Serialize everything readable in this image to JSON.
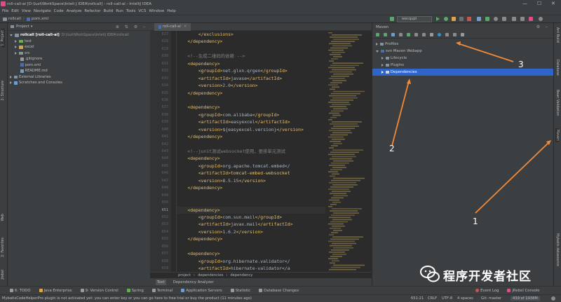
{
  "window": {
    "title": "roll-call-ai [D:\\luzi\\WorkSpace\\Inteli J IDEA\\rollcall] - roll-call-ai - IntelliJ IDEA",
    "controls": [
      "—",
      "☐",
      "✕"
    ]
  },
  "menu": [
    "File",
    "Edit",
    "View",
    "Navigate",
    "Code",
    "Analyze",
    "Refactor",
    "Build",
    "Run",
    "Tools",
    "VCS",
    "Window",
    "Help"
  ],
  "navbar": {
    "project": "rollcall",
    "file": "pom.xml",
    "run_config": "wecqupt"
  },
  "left_strip": [
    "1: Project",
    "2: Structure",
    "Web",
    "2: Favorites",
    "Jrebel"
  ],
  "right_strip": [
    "Ant Build",
    "Database",
    "Bean Validation",
    "Maven",
    "Mybatis datasource"
  ],
  "project_panel": {
    "header": "Project",
    "items": [
      {
        "label": "rollcall [roll-call-ai]",
        "path": "D:\\luzi\\WorkSpace\\InteliJ IDEA\\rollcall",
        "indent": 0,
        "kind": "module"
      },
      {
        "label": "test",
        "indent": 1,
        "kind": "folder-green"
      },
      {
        "label": "excel",
        "indent": 1,
        "kind": "folder-orange"
      },
      {
        "label": "src",
        "indent": 1,
        "kind": "folder"
      },
      {
        "label": ".gitignore",
        "indent": 1,
        "kind": "file"
      },
      {
        "label": "pom.xml",
        "indent": 1,
        "kind": "file-m"
      },
      {
        "label": "README.md",
        "indent": 1,
        "kind": "file"
      },
      {
        "label": "External Libraries",
        "indent": 0,
        "kind": "lib"
      },
      {
        "label": "Scratches and Consoles",
        "indent": 0,
        "kind": "scratch"
      }
    ]
  },
  "editor": {
    "tab": "roll-call-ai",
    "line_numbers": [
      "627",
      "628",
      "629",
      "630",
      "631",
      "632",
      "633",
      "634",
      "635",
      "636",
      "637",
      "638",
      "639",
      "640",
      "641",
      "642",
      "643",
      "644",
      "645",
      "646",
      "647",
      "648",
      "649",
      "650",
      "651",
      "652",
      "653",
      "654",
      "655",
      "656",
      "657",
      "658",
      "659"
    ],
    "current_line": "651",
    "lines": [
      "        </exclusions>",
      "    </dependency>",
      "",
      "    <!--生成二维码的依赖 -->",
      "    <dependency>",
      "        <groupId>net.glxn.qrgen</groupId>",
      "        <artifactId>javase</artifactId>",
      "        <version>2.0</version>",
      "    </dependency>",
      "",
      "    <dependency>",
      "        <groupId>com.alibaba</groupId>",
      "        <artifactId>easyexcel</artifactId>",
      "        <version>${easyexcel.version}</version>",
      "    </dependency>",
      "",
      "    <!--junit测试websocket使用，要排单元测试",
      "    <dependency>",
      "        <groupId>org.apache.tomcat.embed</",
      "        <artifactId>tomcat-embed-websocket",
      "        <version>8.5.15</version>",
      "    </dependency>",
      "",
      "",
      "    <dependency>",
      "        <groupId>com.sun.mail</groupId>",
      "        <artifactId>javax.mail</artifactId>",
      "        <version>1.6.2</version>",
      "    </dependency>",
      "",
      "    <dependency>",
      "        <groupId>org.hibernate.validator</",
      "        <artifactId>hibernate-validator</a"
    ],
    "breadcrumbs": [
      "project",
      "›",
      "dependencies",
      "›",
      "dependency"
    ],
    "subtabs": [
      "Text",
      "Dependency Analyzer"
    ]
  },
  "maven": {
    "header": "Maven",
    "items": [
      {
        "label": "Profiles",
        "indent": 0,
        "expanded": false,
        "selected": false
      },
      {
        "label": "svn Maven Webapp",
        "indent": 0,
        "expanded": true,
        "selected": false
      },
      {
        "label": "Lifecycle",
        "indent": 1,
        "expanded": false,
        "selected": false
      },
      {
        "label": "Plugins",
        "indent": 1,
        "expanded": false,
        "selected": false
      },
      {
        "label": "Dependencies",
        "indent": 1,
        "expanded": false,
        "selected": true
      }
    ]
  },
  "bottom_tools": [
    "6: TODO",
    "Java Enterprise",
    "9: Version Control",
    "Spring",
    "Terminal",
    "Application Servers",
    "Statistic",
    "Database Changes",
    "Event Log",
    "JRebel Console"
  ],
  "status": {
    "message": "MybatisCodeHelperPro plugin is not activated yet: you can enter key or you can go here to free trial or buy the product (11 minutes ago)",
    "position": "651:21",
    "line_sep": "CRLF",
    "encoding": "UTF-8",
    "indent": "4 spaces",
    "vcs": "Git: master",
    "memory": "439 of 1938M"
  },
  "annotations": [
    "1",
    "2",
    "3"
  ],
  "watermark": "程序开发者社区",
  "colors": {
    "selection": "#2f65ca",
    "arrow": "#f08a3a",
    "tag": "#e8bf6a",
    "text": "#a9b7c6",
    "comment": "#808080"
  }
}
